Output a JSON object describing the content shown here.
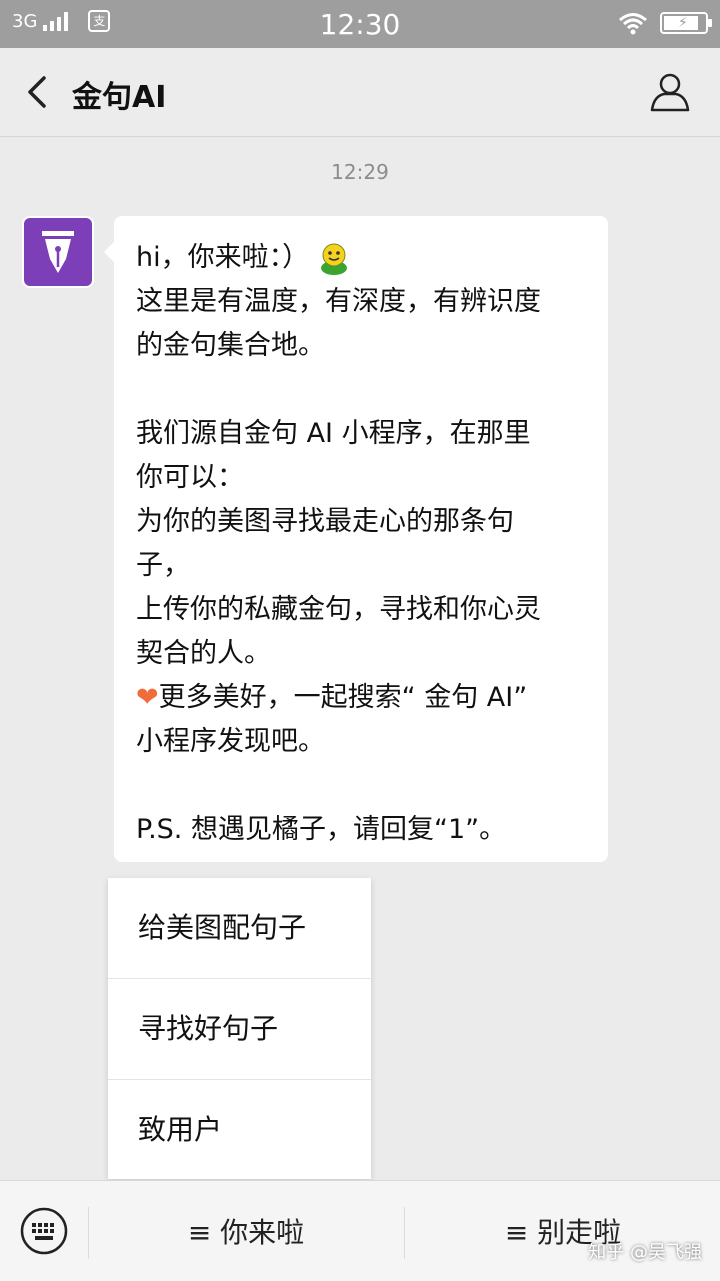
{
  "status_bar": {
    "network": "3G",
    "time": "12:30",
    "alipay_icon_text": "支",
    "battery_level": 0.85
  },
  "header": {
    "title": "金句AI",
    "back_icon": "chevron-left-icon",
    "profile_icon": "person-icon"
  },
  "chat": {
    "timestamp": "12:29",
    "message": {
      "lines": [
        "hi，你来啦：）",
        "这里是有温度，有深度，有辨识度",
        "的金句集合地。",
        "",
        "我们源自金句 AI 小程序，在那里",
        "你可以：",
        "为你的美图寻找最走心的那条句",
        "子，",
        "上传你的私藏金句，寻找和你心灵",
        "契合的人。",
        "更多美好，一起搜索“ 金句 AI”",
        "小程序发现吧。",
        "",
        "P.S. 想遇见橘子，请回复“1”。"
      ],
      "heart_emoji": "❤"
    }
  },
  "popup_menu": {
    "items": [
      "给美图配句子",
      "寻找好句子",
      "致用户"
    ]
  },
  "bottom_bar": {
    "keyboard_icon": "keyboard-icon",
    "tab1": "≡ 你来啦",
    "tab2": "≡ 别走啦"
  },
  "watermark": "知乎 @吴飞强",
  "colors": {
    "avatar_bg": "#7c3fb7",
    "status_bar_bg": "#9e9e9e",
    "chat_bg": "#ebebeb"
  }
}
